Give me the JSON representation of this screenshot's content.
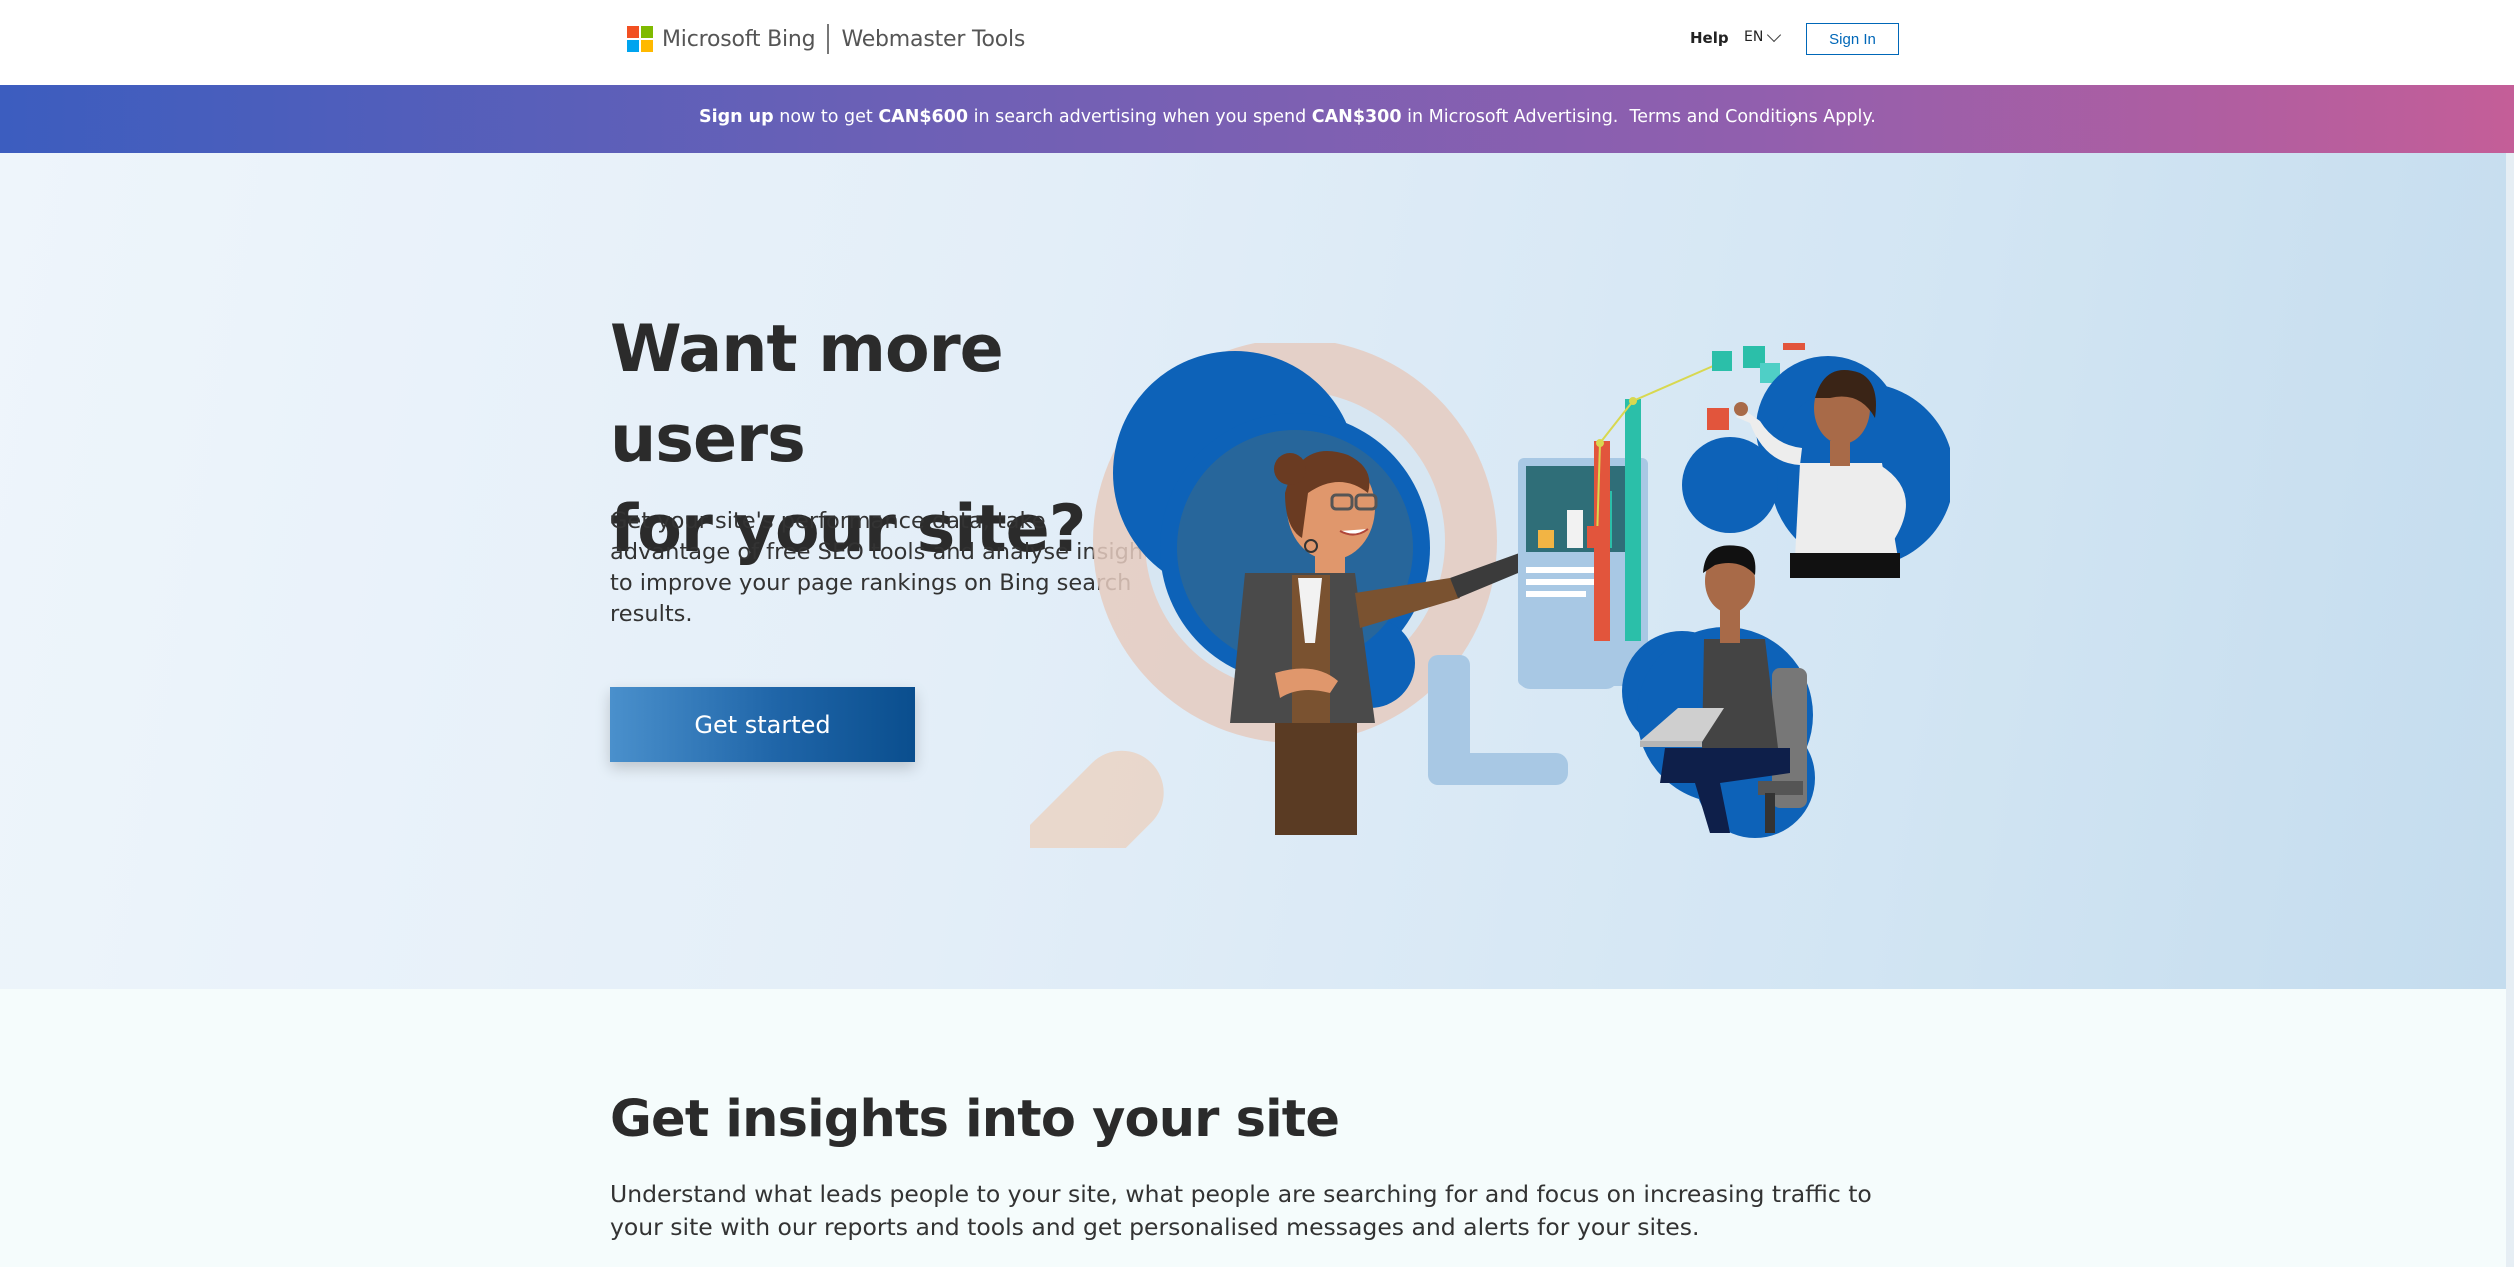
{
  "header": {
    "brand": "Microsoft Bing",
    "product": "Webmaster Tools",
    "help": "Help",
    "language": "EN",
    "sign_in": "Sign In"
  },
  "promo": {
    "signup": "Sign up",
    "t1": " now to get ",
    "amount1": "CAN$600",
    "t2": " in search advertising when you spend ",
    "amount2": "CAN$300",
    "t3": " in Microsoft Advertising.",
    "terms": "Terms and Conditions Apply."
  },
  "hero": {
    "title_line1": "Want more users",
    "title_line2": "for your site?",
    "description": "Get your site's performance data, take advantage of free SEO tools and analyse insights to improve your page rankings on Bing search results.",
    "cta": "Get started"
  },
  "insights": {
    "title": "Get insights into your site",
    "description": "Understand what leads people to your site, what people are searching for and focus on increasing traffic to your site with our reports and tools and get personalised messages and alerts for your sites."
  },
  "colors": {
    "accent": "#0067b8",
    "logo_red": "#f25022",
    "logo_green": "#7fba00",
    "logo_blue": "#00a4ef",
    "logo_yellow": "#ffb900",
    "promo_start": "#3c5dbf",
    "promo_end": "#c45e98"
  }
}
